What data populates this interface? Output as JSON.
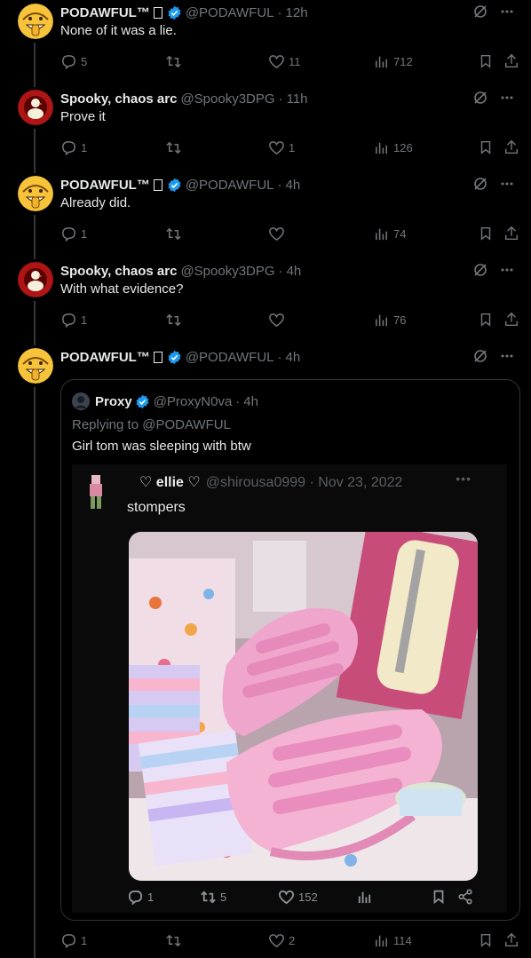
{
  "tweets": [
    {
      "name": "PODAWFUL™",
      "handle": "@PODAWFUL",
      "time": "12h",
      "text": "None of it was a lie.",
      "replies": "5",
      "retweets": "",
      "likes": "11",
      "views": "712",
      "verified": true,
      "avatar": "grinning-emoji"
    },
    {
      "name": "Spooky, chaos arc",
      "handle": "@Spooky3DPG",
      "time": "11h",
      "text": "Prove it",
      "replies": "1",
      "retweets": "",
      "likes": "1",
      "views": "126",
      "verified": false,
      "avatar": "duck-on-red"
    },
    {
      "name": "PODAWFUL™",
      "handle": "@PODAWFUL",
      "time": "4h",
      "text": "Already did.",
      "replies": "1",
      "retweets": "",
      "likes": "",
      "views": "74",
      "verified": true,
      "avatar": "grinning-emoji"
    },
    {
      "name": "Spooky, chaos arc",
      "handle": "@Spooky3DPG",
      "time": "4h",
      "text": "With what evidence?",
      "replies": "1",
      "retweets": "",
      "likes": "",
      "views": "76",
      "verified": false,
      "avatar": "duck-on-red"
    },
    {
      "name": "PODAWFUL™",
      "handle": "@PODAWFUL",
      "time": "4h",
      "text": "",
      "replies": "1",
      "retweets": "",
      "likes": "2",
      "views": "114",
      "verified": true,
      "avatar": "grinning-emoji"
    }
  ],
  "separator": "·",
  "quote": {
    "name": "Proxy",
    "handle": "@ProxyN0va",
    "time": "4h",
    "replying_to": "Replying to @PODAWFUL",
    "text": "Girl tom was sleeping with btw",
    "inner": {
      "name": "♡ ellie ♡",
      "handle": "@shirousa0999 · Nov 23, 2022",
      "text": "stompers",
      "replies": "1",
      "retweets": "5",
      "likes": "152",
      "photo": "pink-velcro-sneakers-striped-socks-guitar"
    }
  },
  "colors": {
    "background": "#000000",
    "text": "#e7e9ea",
    "muted": "#71767b",
    "verified": "#1d9bf0",
    "border": "#2f3336"
  }
}
